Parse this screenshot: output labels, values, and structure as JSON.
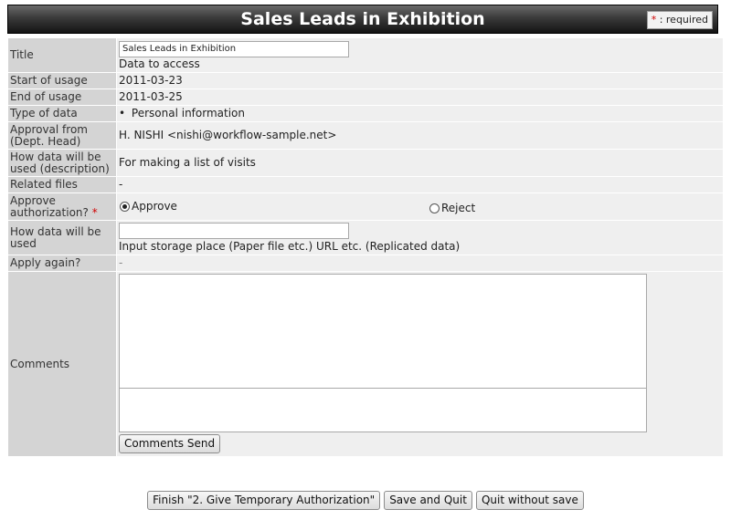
{
  "header": {
    "title": "Sales Leads in Exhibition",
    "required_star": "*",
    "required_text": " : required"
  },
  "form": {
    "title": {
      "label": "Title",
      "value": "Sales Leads in Exhibition",
      "sub": "Data to access"
    },
    "start": {
      "label": "Start of usage",
      "value": "2011-03-23"
    },
    "end": {
      "label": "End of usage",
      "value": "2011-03-25"
    },
    "type": {
      "label": "Type of data",
      "bullet": "•",
      "value": "Personal information"
    },
    "approval": {
      "label": "Approval from (Dept. Head)",
      "value": "H. NISHI <nishi@workflow-sample.net>"
    },
    "usage_desc": {
      "label": "How data will be used (description)",
      "value": "For making a list of visits"
    },
    "related": {
      "label": "Related files",
      "value": "-"
    },
    "approve_auth": {
      "label": "Approve authorization?",
      "star": "*",
      "options": [
        "Approve",
        "Reject"
      ],
      "selected": "Approve"
    },
    "how_used": {
      "label": "How data will be used",
      "value": "",
      "hint": "Input storage place (Paper file etc.) URL etc. (Replicated data)"
    },
    "apply_again": {
      "label": "Apply again?",
      "value": "-"
    },
    "comments": {
      "label": "Comments",
      "send_button": "Comments Send"
    }
  },
  "footer": {
    "finish_button": "Finish \"2. Give Temporary Authorization\"",
    "save_quit_button": "Save and Quit",
    "quit_no_save_button": "Quit without save"
  }
}
